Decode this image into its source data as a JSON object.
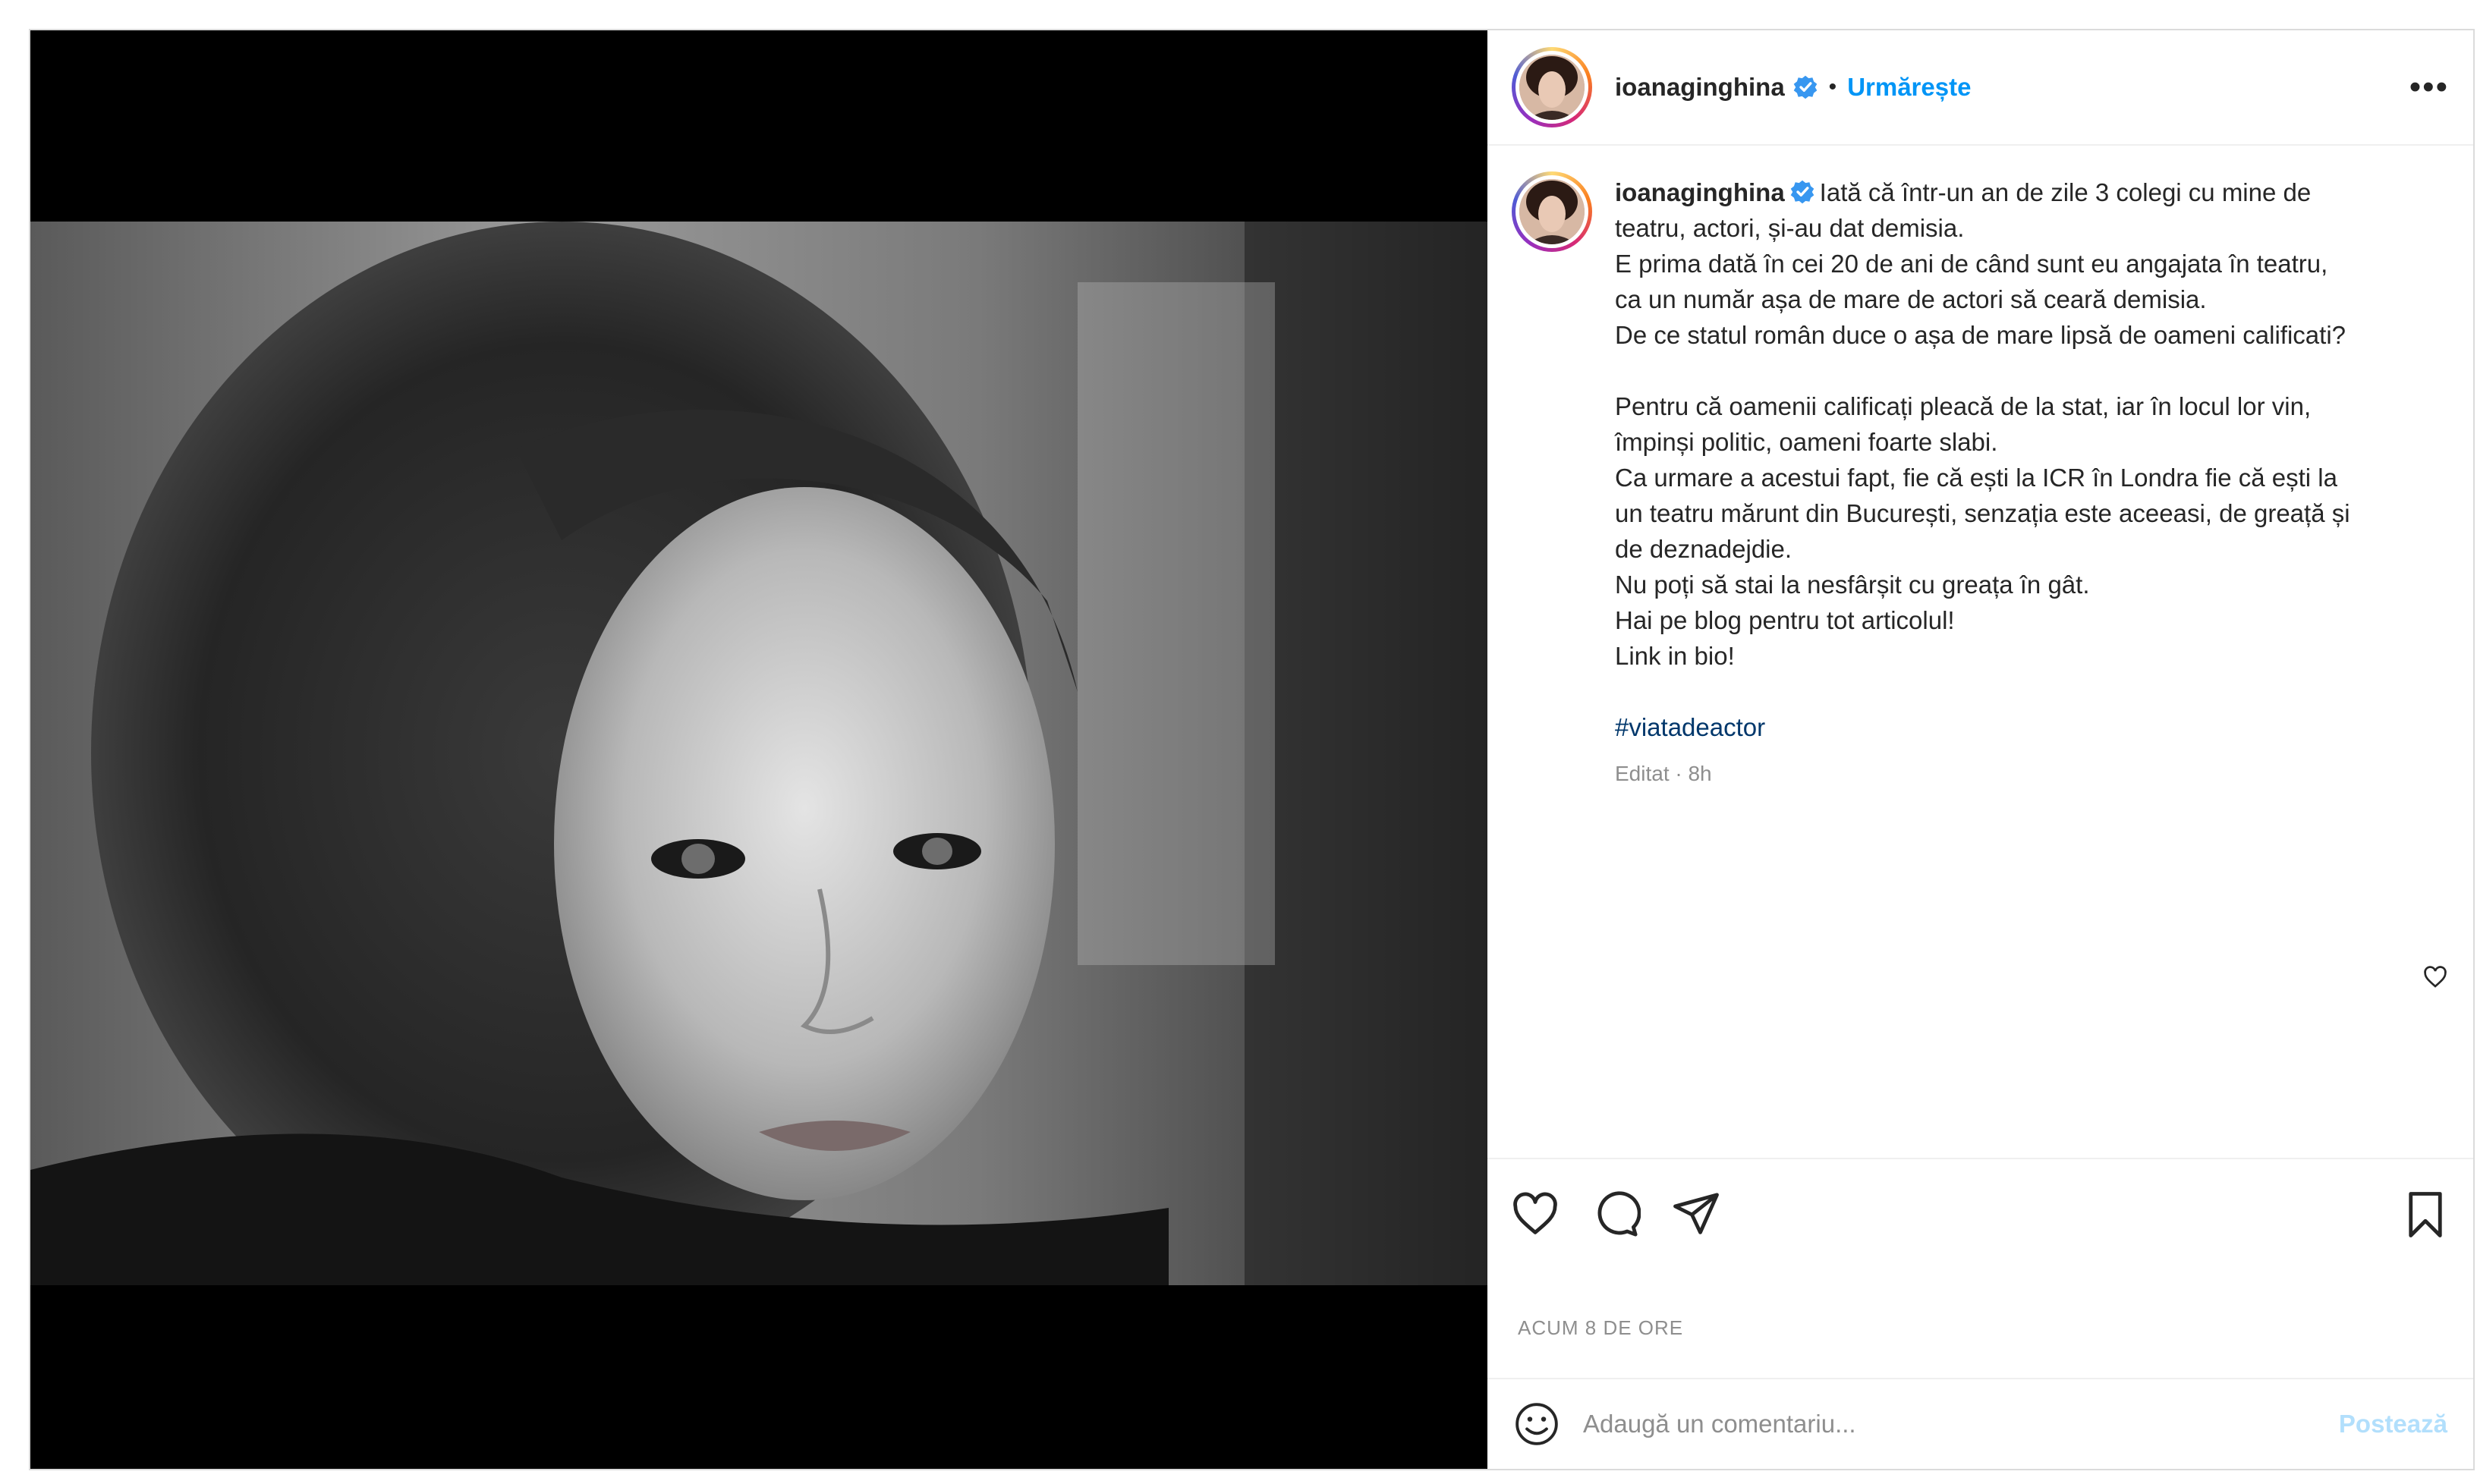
{
  "post": {
    "username": "ioanaginghina",
    "follow_label": "Urmărește",
    "separator": "•",
    "more_label": "•••",
    "caption": {
      "username": "ioanaginghina",
      "lines_block1": [
        "Iată că într-un an de zile 3 colegi cu mine de",
        "teatru, actori, și-au dat demisia.",
        "E prima dată în cei 20 de ani de când sunt eu angajata în teatru,",
        "ca un număr așa de mare de actori să ceară demisia.",
        "De ce statul român duce o așa de mare lipsă de oameni calificati?"
      ],
      "lines_block2": [
        "Pentru că oamenii calificați pleacă de la stat, iar în locul lor vin,",
        "împinși politic, oameni foarte slabi.",
        "Ca urmare a acestui fapt, fie că ești la ICR în Londra fie că ești la",
        "un teatru mărunt din București, senzația este aceeasi, de greață și",
        "de deznadejdie.",
        "Nu poți să stai la nesfârșit cu greața în gât.",
        "Hai pe blog pentru tot articolul!",
        "Link in bio!"
      ],
      "hashtag": "#viatadeactor",
      "meta": "Editat · 8h"
    },
    "timestamp": "ACUM 8 DE ORE",
    "comment": {
      "placeholder": "Adaugă un comentariu...",
      "post_label": "Postează"
    },
    "icons": {
      "verified": "verified-badge-icon",
      "like": "heart-icon",
      "comment": "comment-bubble-icon",
      "share": "paper-plane-icon",
      "save": "bookmark-icon",
      "emoji": "smiley-icon",
      "more": "more-options-icon"
    },
    "colors": {
      "accent": "#0095f6",
      "hashtag": "#00376b",
      "muted": "#8e8e8e",
      "post_disabled": "#b2dffc"
    }
  }
}
